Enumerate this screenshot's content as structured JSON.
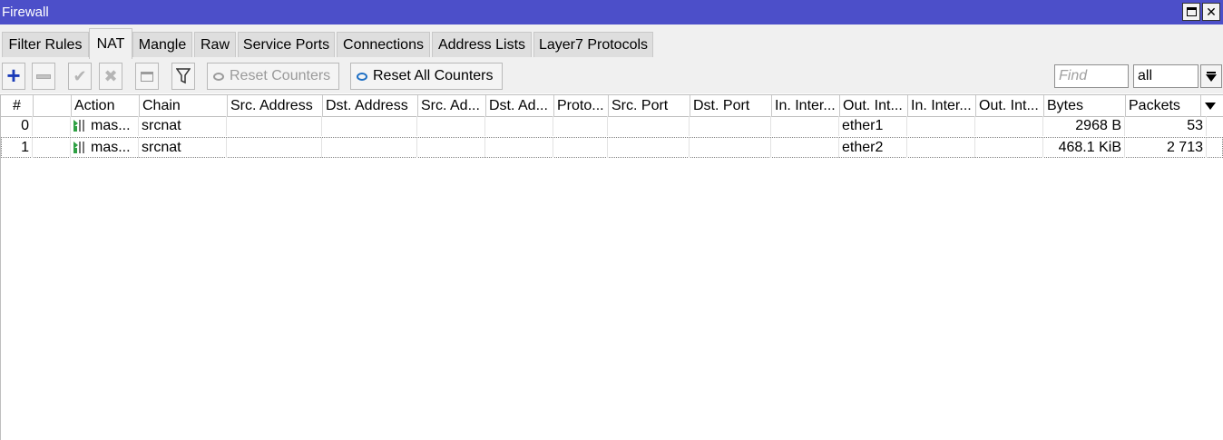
{
  "window": {
    "title": "Firewall"
  },
  "tabs": [
    {
      "label": "Filter Rules"
    },
    {
      "label": "NAT"
    },
    {
      "label": "Mangle"
    },
    {
      "label": "Raw"
    },
    {
      "label": "Service Ports"
    },
    {
      "label": "Connections"
    },
    {
      "label": "Address Lists"
    },
    {
      "label": "Layer7 Protocols"
    }
  ],
  "active_tab": "NAT",
  "toolbar": {
    "reset_counters": "Reset Counters",
    "reset_all_counters": "Reset All Counters",
    "find_placeholder": "Find",
    "filter_value": "all"
  },
  "table": {
    "columns": [
      "#",
      "",
      "Action",
      "Chain",
      "Src. Address",
      "Dst. Address",
      "Src. Ad...",
      "Dst. Ad...",
      "Proto...",
      "Src. Port",
      "Dst. Port",
      "In. Inter...",
      "Out. Int...",
      "In. Inter...",
      "Out. Int...",
      "Bytes",
      "Packets"
    ],
    "rows": [
      {
        "num": "0",
        "action": "mas...",
        "chain": "srcnat",
        "out_interface": "ether1",
        "bytes": "2968 B",
        "packets": "53"
      },
      {
        "num": "1",
        "action": "mas...",
        "chain": "srcnat",
        "out_interface": "ether2",
        "bytes": "468.1 KiB",
        "packets": "2 713"
      }
    ]
  }
}
